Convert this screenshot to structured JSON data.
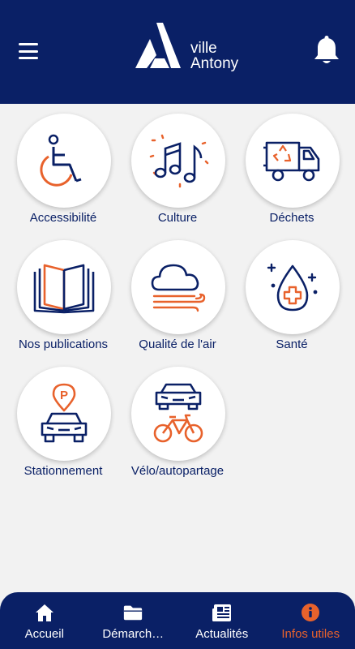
{
  "header": {
    "logo_line1": "ville",
    "logo_line2": "Antony"
  },
  "tiles": [
    {
      "label": "Accessibilité",
      "icon": "wheelchair-icon"
    },
    {
      "label": "Culture",
      "icon": "music-notes-icon"
    },
    {
      "label": "Déchets",
      "icon": "garbage-truck-icon"
    },
    {
      "label": "Nos publications",
      "icon": "open-book-icon"
    },
    {
      "label": "Qualité de l'air",
      "icon": "cloud-wind-icon"
    },
    {
      "label": "Santé",
      "icon": "health-drop-icon"
    },
    {
      "label": "Stationnement",
      "icon": "parking-car-icon"
    },
    {
      "label": "Vélo/autopartage",
      "icon": "car-bike-icon"
    }
  ],
  "tabbar": {
    "items": [
      {
        "label": "Accueil",
        "icon": "home-icon",
        "active": false
      },
      {
        "label": "Démarch…",
        "icon": "folder-icon",
        "active": false
      },
      {
        "label": "Actualités",
        "icon": "newspaper-icon",
        "active": false
      },
      {
        "label": "Infos utiles",
        "icon": "info-icon",
        "active": true
      }
    ]
  },
  "colors": {
    "navy": "#0a2066",
    "accent": "#e8622c",
    "background": "#f2f2f2"
  }
}
